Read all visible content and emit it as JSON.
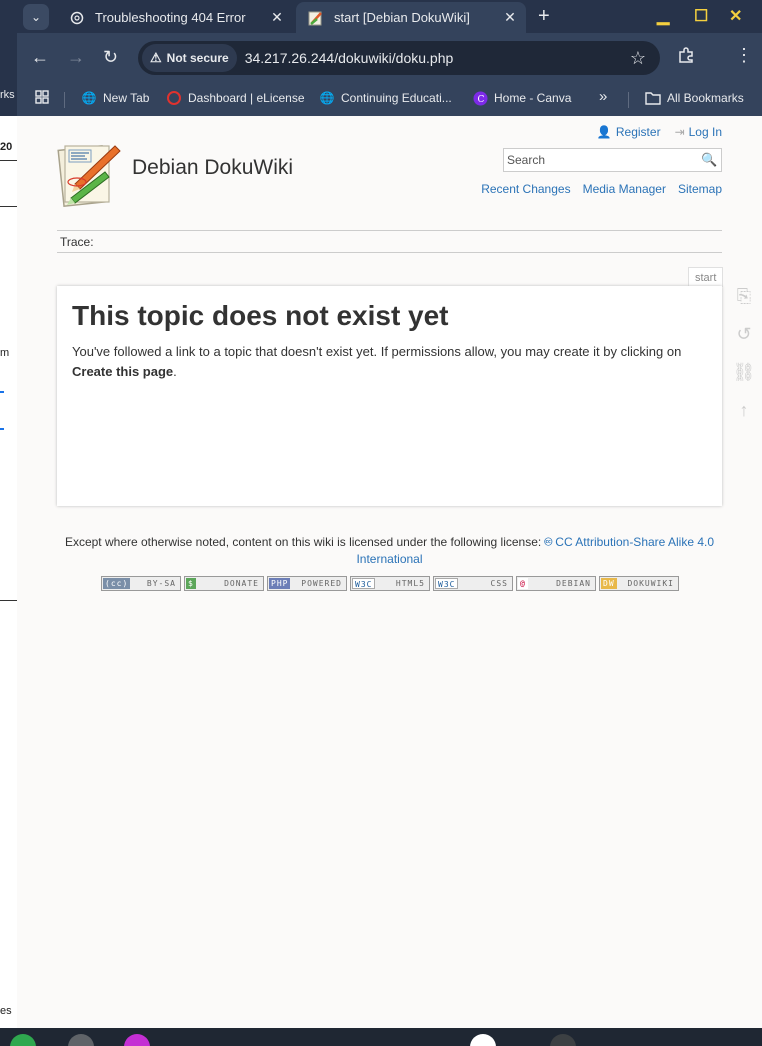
{
  "behind": {
    "fragments": [
      "rks",
      "20",
      "m",
      "es"
    ]
  },
  "tabs": [
    {
      "title": "Troubleshooting 404 Error",
      "icon": "chatgpt-icon",
      "active": false
    },
    {
      "title": "start [Debian DokuWiki]",
      "icon": "dokuwiki-favicon",
      "active": true
    }
  ],
  "toolbar": {
    "security_label": "Not secure",
    "url": "34.217.26.244/dokuwiki/doku.php"
  },
  "bookmarks": [
    {
      "label": "New Tab",
      "icon": "globe-icon"
    },
    {
      "label": "Dashboard | eLicense",
      "icon": "circle-icon"
    },
    {
      "label": "Continuing Educati...",
      "icon": "globe-icon"
    },
    {
      "label": "Home - Canva",
      "icon": "canva-icon"
    },
    {
      "label": "All Bookmarks",
      "icon": "folder-icon"
    }
  ],
  "wiki": {
    "title": "Debian DokuWiki",
    "user_tools": {
      "register": "Register",
      "login": "Log In"
    },
    "search_placeholder": "Search",
    "site_tools": {
      "recent": "Recent Changes",
      "media": "Media Manager",
      "sitemap": "Sitemap"
    },
    "trace_label": "Trace:",
    "page_id": "start",
    "heading": "This topic does not exist yet",
    "body_text": "You've followed a link to a topic that doesn't exist yet. If permissions allow, you may create it by clicking on ",
    "body_link": "Create this page",
    "body_end": ".",
    "license_text": "Except where otherwise noted, content on this wiki is licensed under the following license: ",
    "license_link": "CC Attribution-Share Alike 4.0 International",
    "badges": [
      {
        "tag": "(cc)",
        "label": "BY-SA"
      },
      {
        "tag": "$",
        "label": "DONATE"
      },
      {
        "tag": "PHP",
        "label": "POWERED"
      },
      {
        "tag": "W3C",
        "label": "HTML5"
      },
      {
        "tag": "W3C",
        "label": "CSS"
      },
      {
        "tag": "@",
        "label": "DEBIAN"
      },
      {
        "tag": "DW",
        "label": "DOKUWIKI"
      }
    ]
  }
}
